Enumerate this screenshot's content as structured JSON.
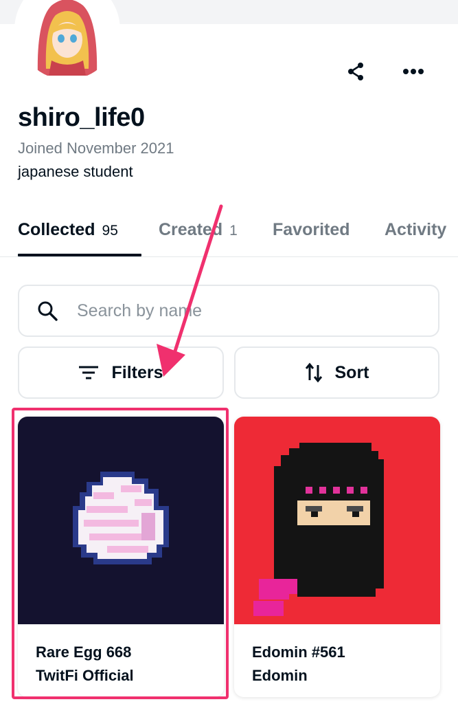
{
  "profile": {
    "username": "shiro_life0",
    "joined": "Joined November 2021",
    "bio": "japanese student"
  },
  "header": {
    "share_icon": "share-icon",
    "more_icon": "more-horizontal-icon"
  },
  "tabs": [
    {
      "label": "Collected",
      "count": "95"
    },
    {
      "label": "Created",
      "count": "1"
    },
    {
      "label": "Favorited"
    },
    {
      "label": "Activity"
    }
  ],
  "search": {
    "placeholder": "Search by name",
    "icon": "search-icon"
  },
  "controls": {
    "filters_label": "Filters",
    "sort_label": "Sort"
  },
  "items": [
    {
      "name": "Rare Egg 668",
      "collection": "TwitFi Official",
      "background": "#14122f"
    },
    {
      "name": "Edomin #561",
      "collection": "Edomin",
      "background": "#ee2a36"
    }
  ],
  "annotation": {
    "color": "#f0306e"
  }
}
